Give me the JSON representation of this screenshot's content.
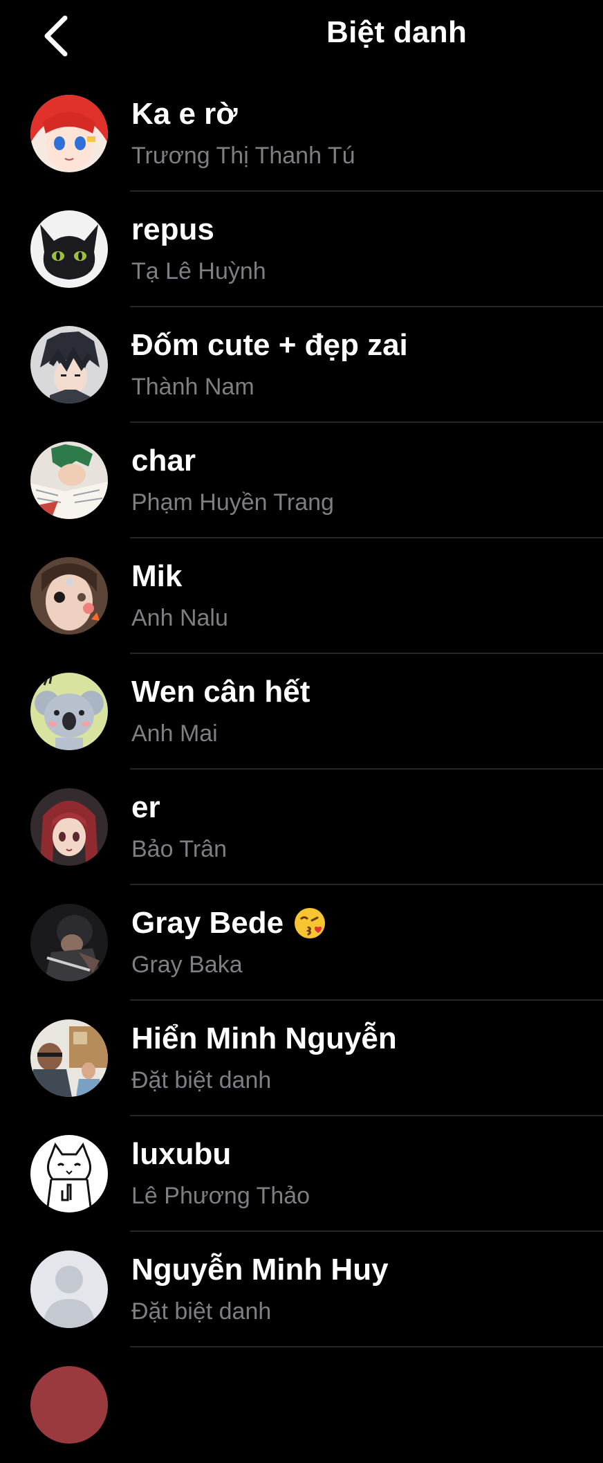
{
  "header": {
    "title": "Biệt danh",
    "back_icon": "chevron-left-icon"
  },
  "colors": {
    "background": "#000000",
    "primary_text": "#ffffff",
    "secondary_text": "#7e7e83",
    "divider": "#262628"
  },
  "contacts": [
    {
      "nickname": "Ka e rờ",
      "name": "Trương Thị Thanh Tú",
      "avatar": "anime-girl-red-hair"
    },
    {
      "nickname": "repus",
      "name": "Tạ Lê Huỳnh",
      "avatar": "black-dragon"
    },
    {
      "nickname": "Đốm cute + đẹp zai",
      "name": "Thành Nam",
      "avatar": "anime-boy-dark-hair"
    },
    {
      "nickname": "char",
      "name": "Phạm Huyền Trang",
      "avatar": "anime-boy-green-hair"
    },
    {
      "nickname": "Mik",
      "name": "Anh Nalu",
      "avatar": "girl-photo"
    },
    {
      "nickname": "Wen cân hết",
      "name": "Anh Mai",
      "avatar": "koala-cartoon"
    },
    {
      "nickname": "er",
      "name": "Bảo Trân",
      "avatar": "anime-girl-red-hair-2"
    },
    {
      "nickname": "Gray Bede",
      "emoji": "kissing-face-emoji",
      "name": "Gray Baka",
      "avatar": "dark-photo"
    },
    {
      "nickname": "Hiển Minh Nguyễn",
      "name": "Đặt biệt danh",
      "avatar": "people-photo"
    },
    {
      "nickname": "luxubu",
      "name": "Lê Phương Thảo",
      "avatar": "cat-drawing"
    },
    {
      "nickname": "Nguyễn Minh Huy",
      "name": "Đặt biệt danh",
      "avatar": "default-profile"
    }
  ]
}
